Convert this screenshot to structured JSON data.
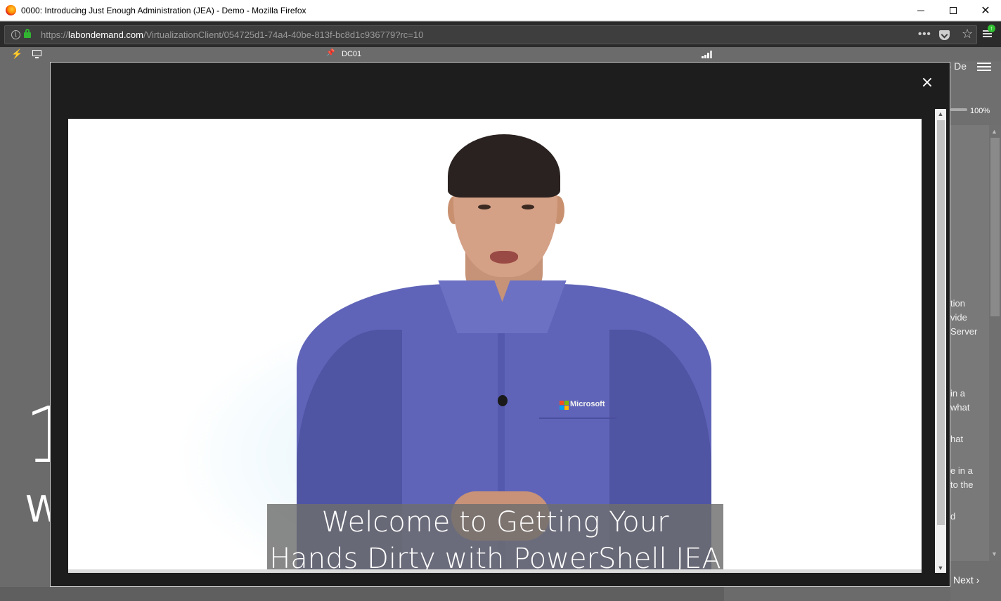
{
  "window": {
    "title": "0000: Introducing Just Enough Administration (JEA) - Demo - Mozilla Firefox",
    "min_label": "—",
    "max_label": "",
    "close_label": "✕"
  },
  "urlbar": {
    "scheme": "https://",
    "host": "labondemand.com",
    "path": "/VirtualizationClient/054725d1-74a4-40be-813f-bc8d1c936779?rc=10",
    "more_label": "•••",
    "star_label": "☆"
  },
  "labbar": {
    "machine": "DC01",
    "pin_label": "📌"
  },
  "background": {
    "title_fragment": ") - De",
    "zoom": "100%",
    "next_label": "Next",
    "big_number": "1",
    "big_letter": "W",
    "text_lines": [
      "tion",
      "vide",
      "Server",
      "in a",
      "what",
      "hat",
      "e in a",
      "to the",
      "d"
    ]
  },
  "modal": {
    "close_label": "×",
    "caption_line1": "Welcome to Getting Your",
    "caption_line2": "Hands Dirty with PowerShell JEA",
    "shirt_brand": "Microsoft"
  },
  "colors": {
    "titlebar": "#ffffff",
    "navbar": "#2b2b2b",
    "overlay": "#6b6b6b",
    "modal": "#1d1d1d",
    "shirt": "#5f64b8",
    "secure_lock": "#31b531"
  }
}
